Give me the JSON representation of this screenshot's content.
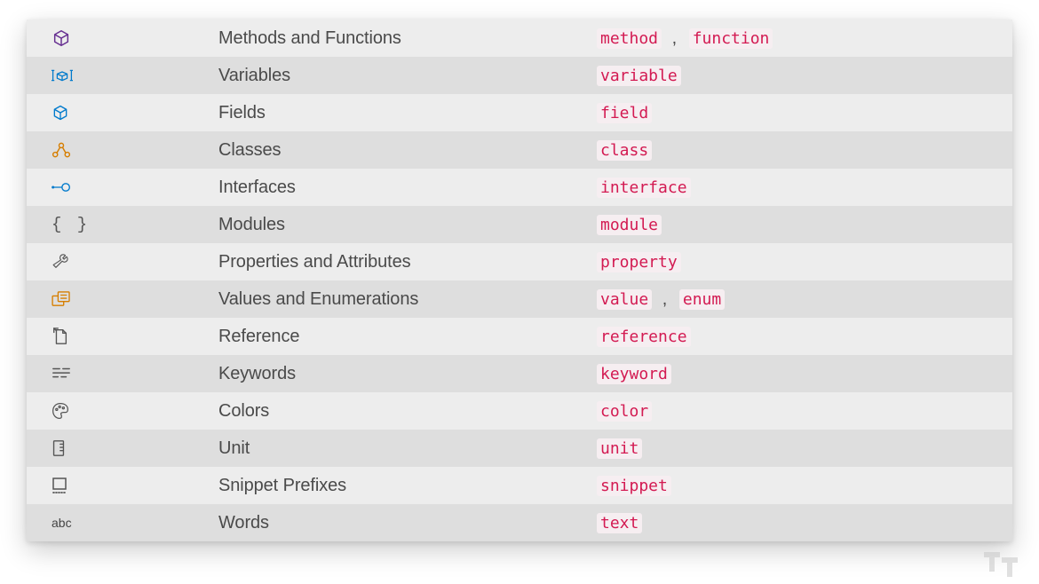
{
  "rows": [
    {
      "icon": "method",
      "label": "Methods and Functions",
      "codes": [
        "method",
        "function"
      ]
    },
    {
      "icon": "variable",
      "label": "Variables",
      "codes": [
        "variable"
      ]
    },
    {
      "icon": "field",
      "label": "Fields",
      "codes": [
        "field"
      ]
    },
    {
      "icon": "class",
      "label": "Classes",
      "codes": [
        "class"
      ]
    },
    {
      "icon": "interface",
      "label": "Interfaces",
      "codes": [
        "interface"
      ]
    },
    {
      "icon": "module",
      "label": "Modules",
      "codes": [
        "module"
      ]
    },
    {
      "icon": "property",
      "label": "Properties and Attributes",
      "codes": [
        "property"
      ]
    },
    {
      "icon": "enum",
      "label": "Values and Enumerations",
      "codes": [
        "value",
        "enum"
      ]
    },
    {
      "icon": "reference",
      "label": "Reference",
      "codes": [
        "reference"
      ]
    },
    {
      "icon": "keyword",
      "label": "Keywords",
      "codes": [
        "keyword"
      ]
    },
    {
      "icon": "color",
      "label": "Colors",
      "codes": [
        "color"
      ]
    },
    {
      "icon": "unit",
      "label": "Unit",
      "codes": [
        "unit"
      ]
    },
    {
      "icon": "snippet",
      "label": "Snippet Prefixes",
      "codes": [
        "snippet"
      ]
    },
    {
      "icon": "text",
      "label": "Words",
      "codes": [
        "text"
      ]
    }
  ],
  "separator": " , ",
  "colors": {
    "purple": "#652d90",
    "blue": "#007acc",
    "orange": "#d67e00",
    "dark": "#555555",
    "code": "#d31a52"
  }
}
